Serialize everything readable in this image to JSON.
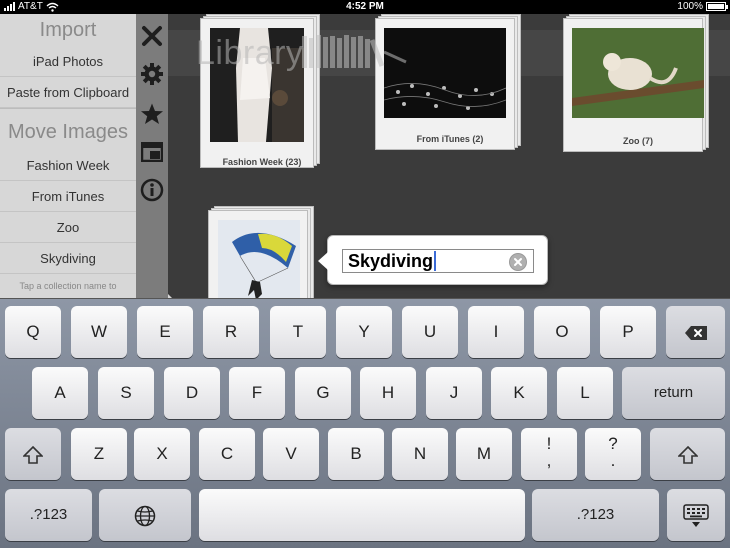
{
  "status_bar": {
    "carrier": "AT&T",
    "time": "4:52 PM",
    "battery": "100%"
  },
  "library": {
    "title": "Library",
    "collections": [
      {
        "caption": "Fashion Week (23)"
      },
      {
        "caption": "From iTunes (2)"
      },
      {
        "caption": "Zoo (7)"
      }
    ]
  },
  "side_panel": {
    "import_title": "Import",
    "import_items": [
      "iPad Photos",
      "Paste from Clipboard"
    ],
    "move_title": "Move Images",
    "move_items": [
      "Fashion Week",
      "From iTunes",
      "Zoo",
      "Skydiving"
    ],
    "hint": "Tap a collection name to"
  },
  "icon_bar": {
    "icons": [
      "close-icon",
      "gear-icon",
      "star-icon",
      "layout-icon",
      "info-icon"
    ]
  },
  "rename_popover": {
    "value": "Skydiving"
  },
  "keyboard": {
    "row1": [
      "Q",
      "W",
      "E",
      "R",
      "T",
      "Y",
      "U",
      "I",
      "O",
      "P"
    ],
    "row2": [
      "A",
      "S",
      "D",
      "F",
      "G",
      "H",
      "J",
      "K",
      "L"
    ],
    "row3": [
      "Z",
      "X",
      "C",
      "V",
      "B",
      "N",
      "M"
    ],
    "return_label": "return",
    "exclaim_top": "!",
    "exclaim_bottom": ",",
    "question_top": "?",
    "question_bottom": ".",
    "numbers_label": ".?123",
    "numbers_label_right": ".?123"
  },
  "colors": {
    "caret": "#3b6bd6",
    "panel": "#d7d7d7",
    "icon_bar": "#7c7c7c"
  }
}
